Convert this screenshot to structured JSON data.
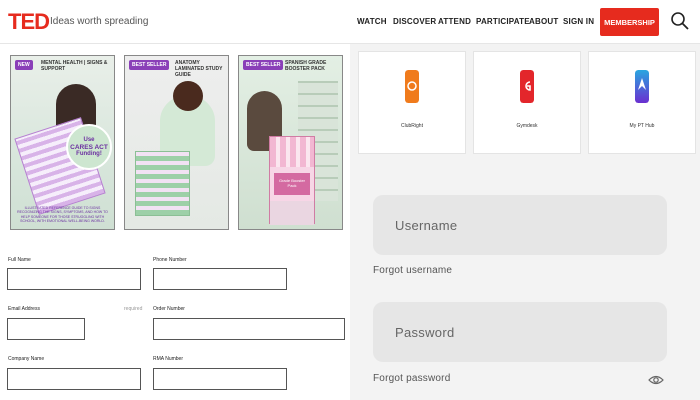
{
  "header": {
    "logo": "TED",
    "tagline": "Ideas worth spreading",
    "nav": [
      "WATCH",
      "DISCOVER",
      "ATTEND",
      "PARTICIPATE",
      "ABOUT",
      "SIGN IN"
    ],
    "membership_label": "MEMBERSHIP",
    "accent_color": "#e62b1e",
    "search_icon": "search-icon"
  },
  "products": [
    {
      "badge": "NEW",
      "title": "MENTAL HEALTH | SIGNS & SUPPORT",
      "bubble": [
        "Use",
        "CARES ACT",
        "Funding!"
      ],
      "footer": "ILLUSTRATED REFERENCE GUIDE TO SIGNS RECOGNIZING THE SIGNS, SYMPTOMS, AND HOW TO HELP SOMEONE FOR THOSE STRUGGLING WITH SCHOOL, WITH EMOTIONAL WELL-BEING WORLD."
    },
    {
      "badge": "BEST SELLER",
      "title": "ANATOMY LAMINATED STUDY GUIDE"
    },
    {
      "badge": "BEST SELLER",
      "title": "SPANISH GRADE BOOSTER PACK",
      "booklet_label": "Grade Booster Pack"
    }
  ],
  "form": {
    "full_name": "Full Name",
    "phone_number": "Phone Number",
    "email_address": "Email Address",
    "required_note": "required",
    "order_number": "Order Number",
    "company_name": "Company Name",
    "rma_number": "RMA Number"
  },
  "apps": [
    {
      "name": "ClubRight",
      "color": "#f07b1c"
    },
    {
      "name": "Gymdesk",
      "color": "#e3262b"
    },
    {
      "name": "My PT Hub",
      "color": "#4a3ad8"
    }
  ],
  "login": {
    "username_placeholder": "Username",
    "forgot_username": "Forgot username",
    "password_placeholder": "Password",
    "forgot_password": "Forgot password",
    "eye_icon": "eye-icon"
  }
}
